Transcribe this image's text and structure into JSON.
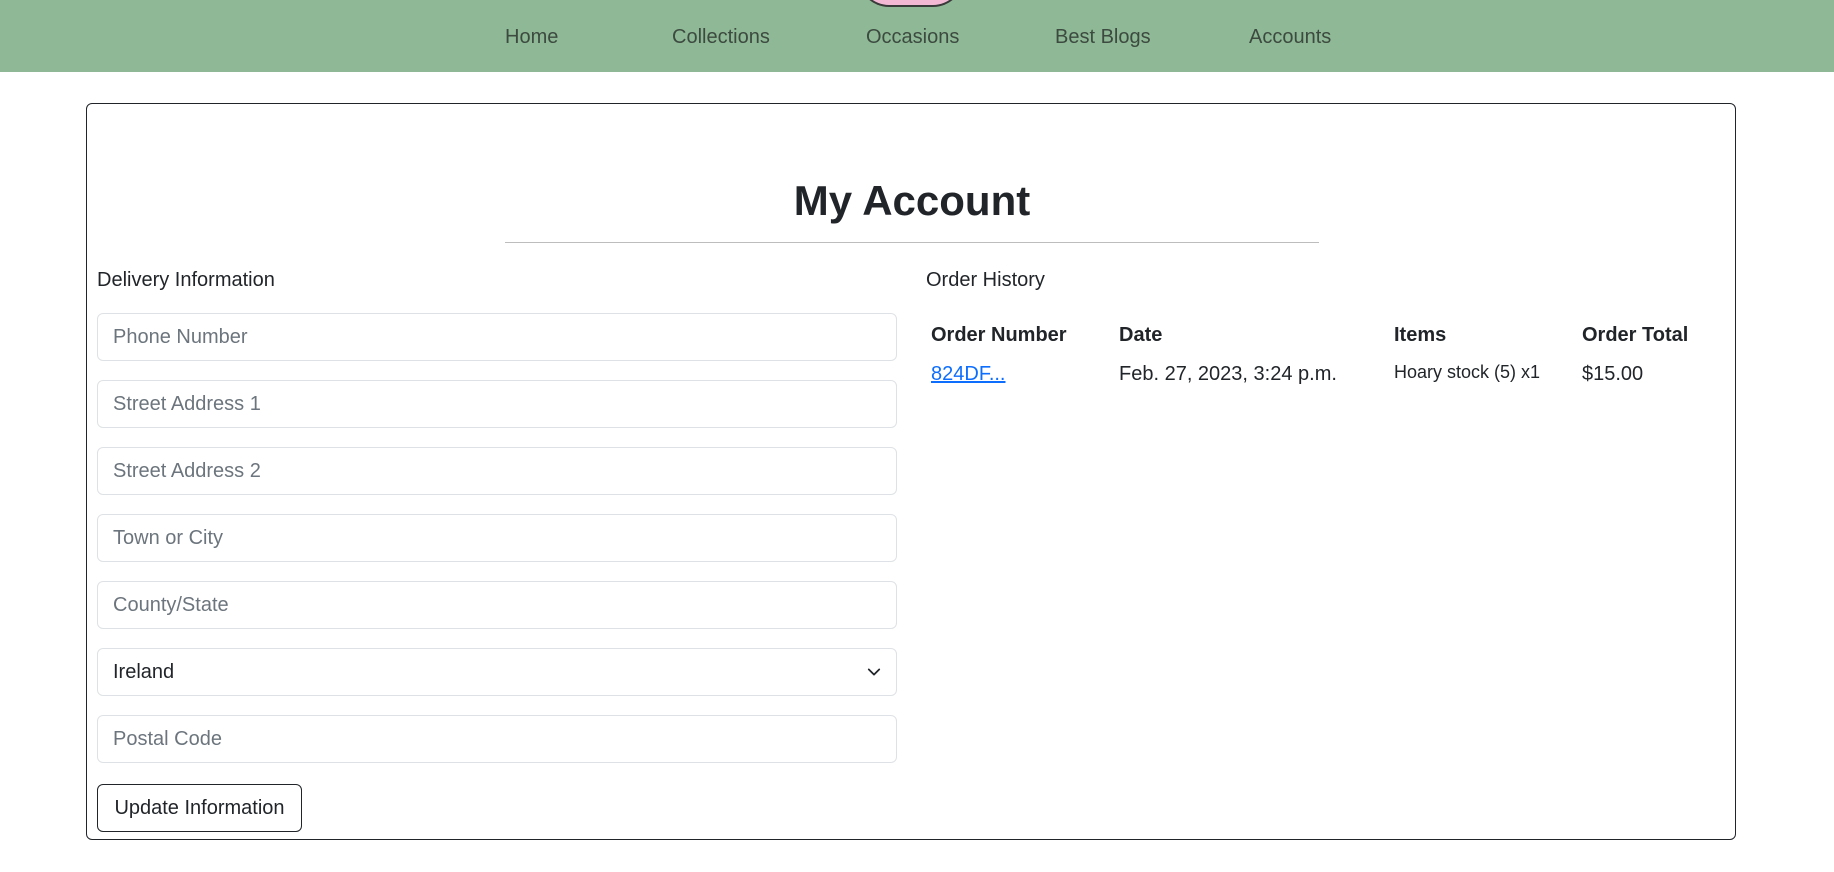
{
  "nav": {
    "items": [
      {
        "label": "Home"
      },
      {
        "label": "Collections"
      },
      {
        "label": "Occasions"
      },
      {
        "label": "Best Blogs"
      },
      {
        "label": "Accounts"
      }
    ]
  },
  "page": {
    "title": "My Account"
  },
  "delivery": {
    "heading": "Delivery Information",
    "phone_placeholder": "Phone Number",
    "street1_placeholder": "Street Address 1",
    "street2_placeholder": "Street Address 2",
    "town_placeholder": "Town or City",
    "county_placeholder": "County/State",
    "country_selected": "Ireland",
    "postcode_placeholder": "Postal Code",
    "update_label": "Update Information"
  },
  "orders": {
    "heading": "Order History",
    "columns": [
      "Order Number",
      "Date",
      "Items",
      "Order Total"
    ],
    "rows": [
      {
        "number": "824DF...",
        "date": "Feb. 27, 2023, 3:24 p.m.",
        "items": "Hoary stock (5) x1",
        "total": "$15.00"
      }
    ]
  },
  "colors": {
    "header_bg": "#8fb996",
    "logo_pink": "#f2b8d4",
    "link": "#0d6efd"
  }
}
